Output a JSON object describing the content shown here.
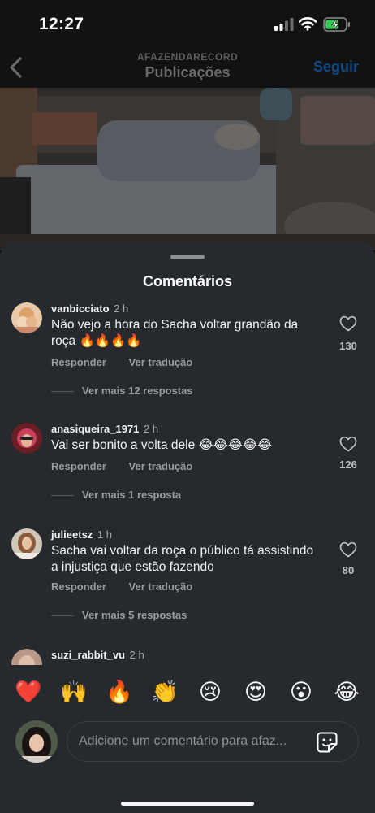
{
  "status_bar": {
    "time": "12:27"
  },
  "header": {
    "account": "AFAZENDARECORD",
    "title": "Publicações",
    "follow_label": "Seguir"
  },
  "sheet": {
    "title": "Comentários",
    "comments": [
      {
        "username": "vanbicciato",
        "time": "2 h",
        "text": "Não vejo a hora do Sacha voltar grandão da roça 🔥🔥🔥🔥",
        "reply_label": "Responder",
        "translate_label": "Ver tradução",
        "likes": "130",
        "view_replies": "Ver mais 12 respostas"
      },
      {
        "username": "anasiqueira_1971",
        "time": "2 h",
        "text": "Vai ser bonito a volta dele 😂😂😂😂😂",
        "reply_label": "Responder",
        "translate_label": "Ver tradução",
        "likes": "126",
        "view_replies": "Ver mais 1 resposta"
      },
      {
        "username": "julieetsz",
        "time": "1 h",
        "text": "Sacha vai voltar da roça o público tá assistindo a injustiça que estão fazendo",
        "reply_label": "Responder",
        "translate_label": "Ver tradução",
        "likes": "80",
        "view_replies": "Ver mais 5 respostas"
      },
      {
        "username": "suzi_rabbit_vu",
        "time": "2 h"
      }
    ],
    "reactions": [
      "❤️",
      "🙌",
      "🔥",
      "👏",
      "😢",
      "😍",
      "😮",
      "😂"
    ],
    "input": {
      "placeholder": "Adicione um comentário para afaz...",
      "value": ""
    }
  },
  "colors": {
    "sheet_bg": "#262a2e",
    "follow_accent": "#0f4a85",
    "muted_text": "#9a9da0"
  },
  "icons": [
    "back-chevron-icon",
    "heart-outline-icon",
    "sticker-icon",
    "signal-icon",
    "wifi-icon",
    "battery-charging-icon"
  ]
}
